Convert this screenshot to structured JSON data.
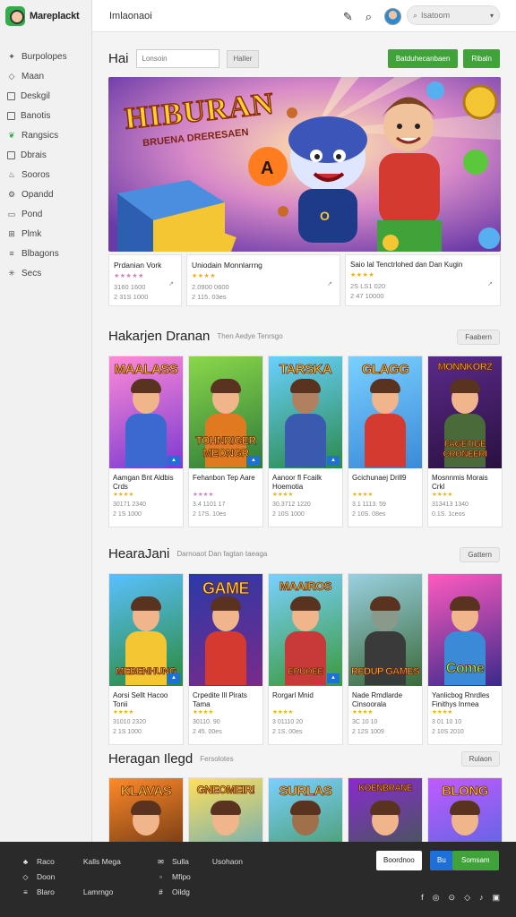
{
  "brand": {
    "name": "Mareplackt"
  },
  "sidebar": {
    "items": [
      {
        "label": "Burpolopes",
        "icon": "pin-icon"
      },
      {
        "label": "Maan",
        "icon": "diamond-icon"
      },
      {
        "label": "Deskgil",
        "icon": "box-icon"
      },
      {
        "label": "Banotis",
        "icon": "box-icon"
      },
      {
        "label": "Rangsics",
        "icon": "leaf-icon"
      },
      {
        "label": "Dbrais",
        "icon": "box-icon"
      },
      {
        "label": "Sooros",
        "icon": "flame-icon"
      },
      {
        "label": "Opandd",
        "icon": "gear-icon"
      },
      {
        "label": "Pond",
        "icon": "window-icon"
      },
      {
        "label": "Plmk",
        "icon": "grid-icon"
      },
      {
        "label": "Blbagons",
        "icon": "list-icon"
      },
      {
        "label": "Secs",
        "icon": "sparkle-icon"
      }
    ]
  },
  "topbar": {
    "title": "Imlaonaoi",
    "search_placeholder": "Isatoom"
  },
  "hero_section": {
    "title": "Hai",
    "filter_placeholder": "Lonsoin",
    "filter_button": "Haller",
    "cta_primary": "Batduhecanbaen",
    "cta_secondary": "Ribaln",
    "banner_title": "HIBURAN",
    "banner_subtitle": "BRUENA DRERESAEN",
    "featured": [
      {
        "title": "Prdanian Vork",
        "stars": "★★★★★",
        "meta1": "3160 1600",
        "meta2": "2 31S 1000"
      },
      {
        "title": "Uniodain Monnlarrng",
        "stars": "★★★★",
        "meta1": "2.0900 0600",
        "meta2": "2 115. 03es"
      },
      {
        "title": "Saio Ial Tenctrlohed dan Dan Kugin",
        "stars": "★★★★",
        "meta1": "2S LS1 020",
        "meta2": "2 47 10000"
      }
    ]
  },
  "section2": {
    "title": "Hakarjen Dranan",
    "subtitle": "Then Aedye Tenrsgo",
    "button": "Faabern",
    "cards": [
      {
        "art": "MAALASS",
        "art2": "",
        "title": "Aamgan Bnt Aldbis Crds",
        "stars": "★★★★",
        "meta1": "30171 2340",
        "meta2": "2 1S 1000"
      },
      {
        "art": "",
        "art2": "TOHNRIGER MEONGR",
        "title": "Fehanbon Tep Aare",
        "stars": "★★★★",
        "meta1": "3.4 1101 17",
        "meta2": "2 17S. 10es"
      },
      {
        "art": "TARSKA",
        "art2": "",
        "title": "Aanoor fl Fcailk Hoemotia",
        "stars": "★★★★",
        "meta1": "30.3712 1220",
        "meta2": "2 10S 1000"
      },
      {
        "art": "GLAGG",
        "art2": "",
        "title": "Gcichunaej Drill9",
        "stars": "★★★★",
        "meta1": "3.1 1113. 59",
        "meta2": "2 10S. 08es"
      },
      {
        "art": "MONNKORZ",
        "art2": "FAGETIGE CRONEERI",
        "title": "Mosnnmis Morais Crkl",
        "stars": "★★★★",
        "meta1": "313413 1340",
        "meta2": "0.1S. 1ceos"
      }
    ]
  },
  "section3": {
    "title": "HearaJani",
    "subtitle": "Darnoaot Dan fagtan taeaga",
    "button": "Gattern",
    "cards": [
      {
        "art": "",
        "art2": "MEBENHUNG",
        "title": "Aorsi Sellt Hacoo Tonii",
        "stars": "★★★★",
        "meta1": "31010 2320",
        "meta2": "2 1S 1000"
      },
      {
        "art": "GAME",
        "art2": "",
        "title": "Crpedite Ill Pirats Tama",
        "stars": "★★★★",
        "meta1": "30110. 90",
        "meta2": "2 45. 00es"
      },
      {
        "art": "MAAIROS",
        "art2": "ERUOEE",
        "title": "Rorgarl Mnid",
        "stars": "★★★★",
        "meta1": "3 01110 20",
        "meta2": "2 1S. 00es"
      },
      {
        "art": "",
        "art2": "REDUP GAMES",
        "title": "Nade Rmdlarde Cinsoorala",
        "stars": "★★★★",
        "meta1": "3C 10 10",
        "meta2": "2 12S 1009"
      },
      {
        "art": "",
        "art2": "Come",
        "title": "Yanlicbog Rnrdles Finithys Inrnea",
        "stars": "★★★★",
        "meta1": "3 01 10 10",
        "meta2": "2 10S 2010"
      }
    ]
  },
  "section4": {
    "title": "Heragan Ilegd",
    "subtitle": "Fersolotes",
    "button": "Rulaon",
    "cards": [
      {
        "art": "KLAVAS"
      },
      {
        "art": "GNEOMEIR!"
      },
      {
        "art": "SURLAS"
      },
      {
        "art": "KOENBRANE"
      },
      {
        "art": "BLONG"
      }
    ]
  },
  "footer": {
    "col1": [
      {
        "icon": "bell-icon",
        "label": "Raco",
        "extra": "Kalls Mega"
      },
      {
        "icon": "diamond-icon",
        "label": "Doon",
        "extra": ""
      },
      {
        "icon": "list-icon",
        "label": "Blaro",
        "extra": "Lamrngo"
      }
    ],
    "col2": [
      {
        "icon": "chat-icon",
        "label": "Sulla",
        "extra": "Usohaon"
      },
      {
        "icon": "square-icon",
        "label": "Mfipo",
        "extra": ""
      },
      {
        "icon": "hash-icon",
        "label": "Oildg",
        "extra": ""
      }
    ],
    "btn_white": "Boordnoo",
    "btn_blue": "Bu",
    "btn_green": "Somsam",
    "social": [
      "f",
      "◎",
      "⊙",
      "◇",
      "♪",
      "▣"
    ]
  },
  "colors": {
    "accent_green": "#3fa33a",
    "accent_blue": "#1e6fd8",
    "footer_bg": "#2a2a2a"
  }
}
